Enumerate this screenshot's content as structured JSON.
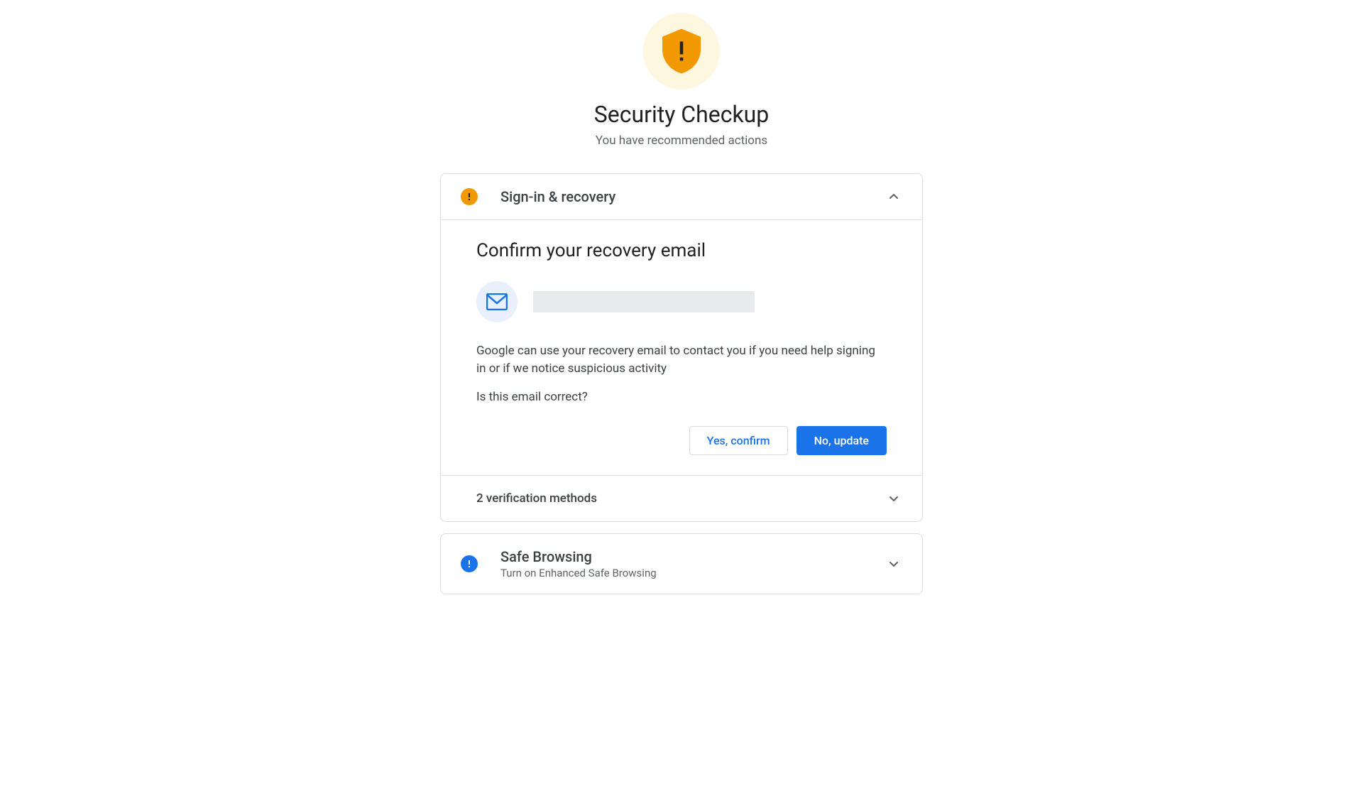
{
  "header": {
    "title": "Security Checkup",
    "subtitle": "You have recommended actions"
  },
  "sections": [
    {
      "title": "Sign-in & recovery",
      "body": {
        "title": "Confirm your recovery email",
        "description": "Google can use your recovery email to contact you if you need help signing in or if we notice suspicious activity",
        "prompt": "Is this email correct?",
        "confirm_label": "Yes, confirm",
        "update_label": "No, update"
      },
      "subsection_title": "2 verification methods"
    },
    {
      "title": "Safe Browsing",
      "subtitle": "Turn on Enhanced Safe Browsing"
    }
  ]
}
